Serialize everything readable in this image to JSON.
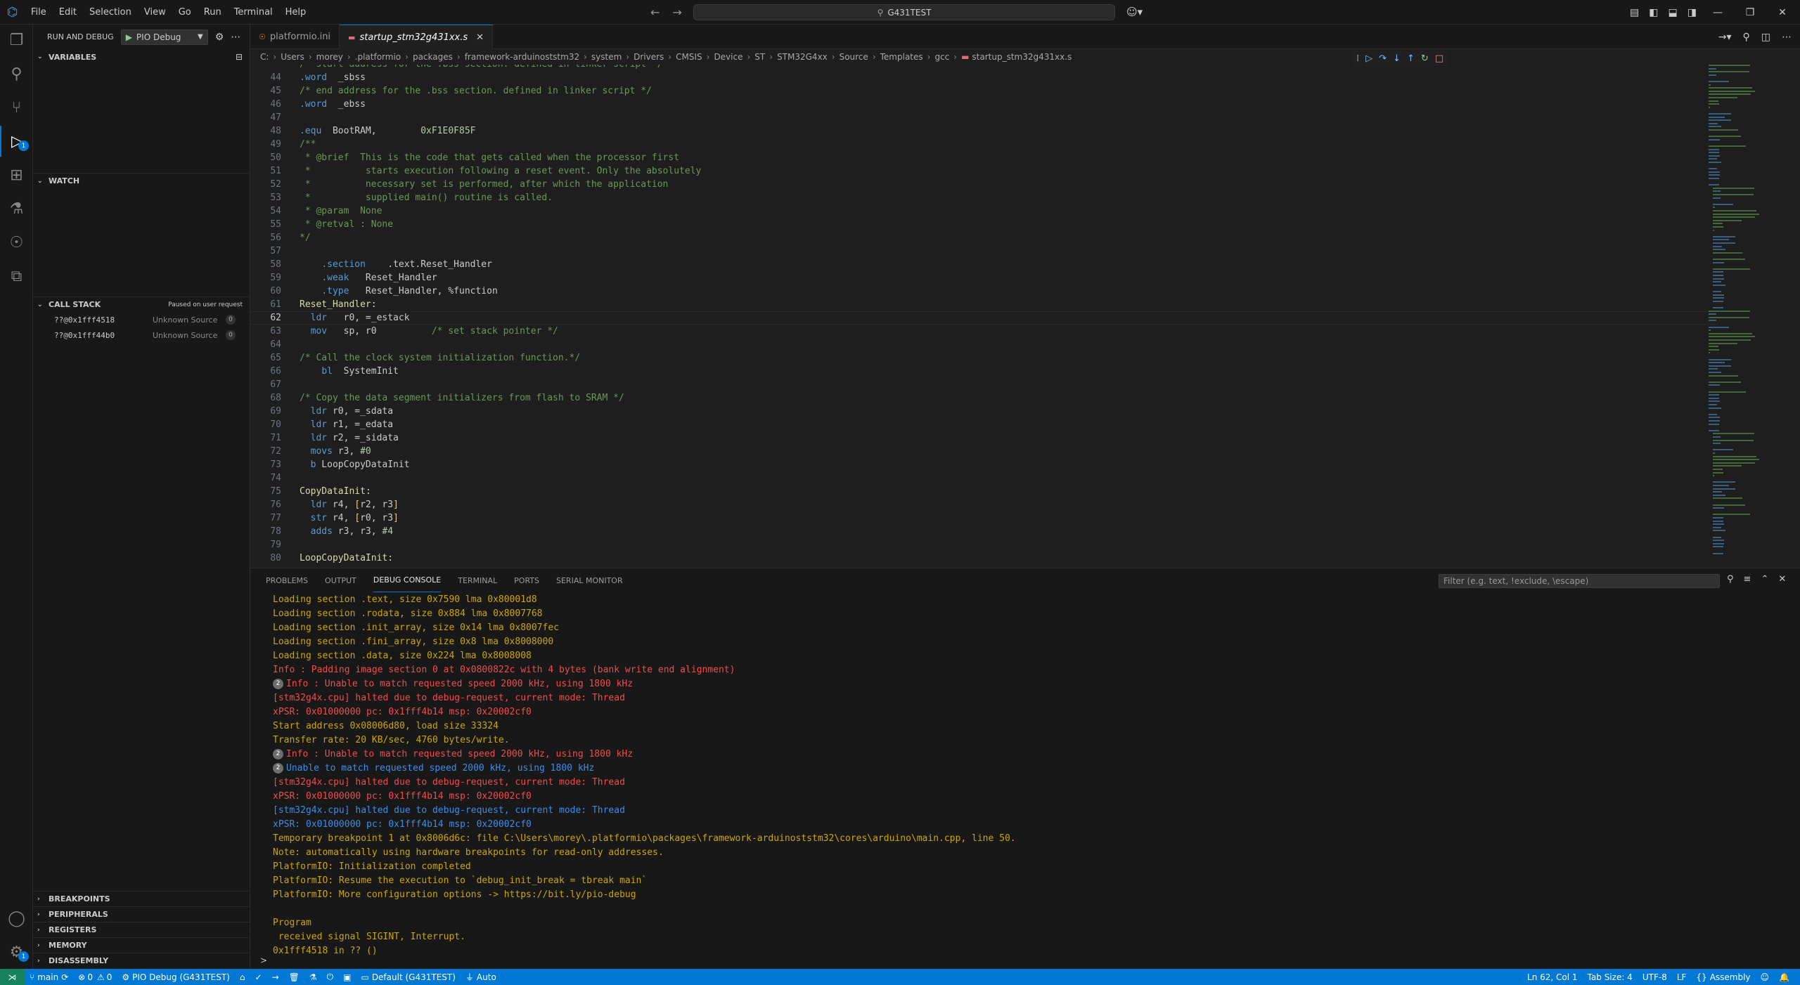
{
  "titlebar": {
    "menu": [
      "File",
      "Edit",
      "Selection",
      "View",
      "Go",
      "Run",
      "Terminal",
      "Help"
    ],
    "search": "G431TEST"
  },
  "sidebar": {
    "title": "RUN AND DEBUG",
    "config": "PIO Debug",
    "sections": {
      "variables": "VARIABLES",
      "watch": "WATCH",
      "callstack": "CALL STACK",
      "callstack_status": "Paused on user request",
      "breakpoints": "BREAKPOINTS",
      "peripherals": "PERIPHERALS",
      "registers": "REGISTERS",
      "memory": "MEMORY",
      "disassembly": "DISASSEMBLY"
    },
    "callstack": [
      {
        "fn": "??@0x1fff4518",
        "src": "Unknown Source",
        "count": "0"
      },
      {
        "fn": "??@0x1fff44b0",
        "src": "Unknown Source",
        "count": "0"
      }
    ]
  },
  "tabs": [
    {
      "label": "platformio.ini",
      "active": false
    },
    {
      "label": "startup_stm32g431xx.s",
      "active": true
    }
  ],
  "breadcrumb": [
    "C:",
    "Users",
    "morey",
    ".platformio",
    "packages",
    "framework-arduinoststm32",
    "system",
    "Drivers",
    "CMSIS",
    "Device",
    "ST",
    "STM32G4xx",
    "Source",
    "Templates",
    "gcc",
    "startup_stm32g431xx.s"
  ],
  "editor": {
    "current_line": 62,
    "lines": [
      {
        "n": "",
        "text": "/* start address for the .bss section. defined in linker script */"
      },
      {
        "n": "44",
        "text": ".word  _sbss"
      },
      {
        "n": "45",
        "text": "/* end address for the .bss section. defined in linker script */"
      },
      {
        "n": "46",
        "text": ".word  _ebss"
      },
      {
        "n": "47",
        "text": ""
      },
      {
        "n": "48",
        "text": ".equ  BootRAM,        0xF1E0F85F"
      },
      {
        "n": "49",
        "text": "/**"
      },
      {
        "n": "50",
        "text": " * @brief  This is the code that gets called when the processor first"
      },
      {
        "n": "51",
        "text": " *          starts execution following a reset event. Only the absolutely"
      },
      {
        "n": "52",
        "text": " *          necessary set is performed, after which the application"
      },
      {
        "n": "53",
        "text": " *          supplied main() routine is called."
      },
      {
        "n": "54",
        "text": " * @param  None"
      },
      {
        "n": "55",
        "text": " * @retval : None"
      },
      {
        "n": "56",
        "text": "*/"
      },
      {
        "n": "57",
        "text": ""
      },
      {
        "n": "58",
        "text": "    .section    .text.Reset_Handler"
      },
      {
        "n": "59",
        "text": "    .weak   Reset_Handler"
      },
      {
        "n": "60",
        "text": "    .type   Reset_Handler, %function"
      },
      {
        "n": "61",
        "text": "Reset_Handler:"
      },
      {
        "n": "62",
        "text": "  ldr   r0, =_estack"
      },
      {
        "n": "63",
        "text": "  mov   sp, r0          /* set stack pointer */"
      },
      {
        "n": "64",
        "text": ""
      },
      {
        "n": "65",
        "text": "/* Call the clock system initialization function.*/"
      },
      {
        "n": "66",
        "text": "    bl  SystemInit"
      },
      {
        "n": "67",
        "text": ""
      },
      {
        "n": "68",
        "text": "/* Copy the data segment initializers from flash to SRAM */"
      },
      {
        "n": "69",
        "text": "  ldr r0, =_sdata"
      },
      {
        "n": "70",
        "text": "  ldr r1, =_edata"
      },
      {
        "n": "71",
        "text": "  ldr r2, =_sidata"
      },
      {
        "n": "72",
        "text": "  movs r3, #0"
      },
      {
        "n": "73",
        "text": "  b LoopCopyDataInit"
      },
      {
        "n": "74",
        "text": ""
      },
      {
        "n": "75",
        "text": "CopyDataInit:"
      },
      {
        "n": "76",
        "text": "  ldr r4, [r2, r3]"
      },
      {
        "n": "77",
        "text": "  str r4, [r0, r3]"
      },
      {
        "n": "78",
        "text": "  adds r3, r3, #4"
      },
      {
        "n": "79",
        "text": ""
      },
      {
        "n": "80",
        "text": "LoopCopyDataInit:"
      }
    ]
  },
  "panel": {
    "tabs": [
      "PROBLEMS",
      "OUTPUT",
      "DEBUG CONSOLE",
      "TERMINAL",
      "PORTS",
      "SERIAL MONITOR"
    ],
    "active_tab": "DEBUG CONSOLE",
    "filter_placeholder": "Filter (e.g. text, !exclude, \\escape)",
    "console": [
      {
        "c": "yel",
        "t": "Loading section .text, size 0x7590 lma 0x80001d8"
      },
      {
        "c": "yel",
        "t": "Loading section .rodata, size 0x884 lma 0x8007768"
      },
      {
        "c": "yel",
        "t": "Loading section .init_array, size 0x14 lma 0x8007fec"
      },
      {
        "c": "yel",
        "t": "Loading section .fini_array, size 0x8 lma 0x8008000"
      },
      {
        "c": "yel",
        "t": "Loading section .data, size 0x224 lma 0x8008008"
      },
      {
        "c": "red",
        "t": "Info : Padding image section 0 at 0x0800822c with 4 bytes (bank write end alignment)"
      },
      {
        "c": "red",
        "t": "Info : Unable to match requested speed 2000 kHz, using 1800 kHz",
        "badge": "2"
      },
      {
        "c": "red",
        "t": "[stm32g4x.cpu] halted due to debug-request, current mode: Thread"
      },
      {
        "c": "red",
        "t": "xPSR: 0x01000000 pc: 0x1fff4b14 msp: 0x20002cf0"
      },
      {
        "c": "yel",
        "t": "Start address 0x08006d80, load size 33324"
      },
      {
        "c": "yel",
        "t": "Transfer rate: 20 KB/sec, 4760 bytes/write."
      },
      {
        "c": "red",
        "t": "Info : Unable to match requested speed 2000 kHz, using 1800 kHz",
        "badge": "2"
      },
      {
        "c": "blu",
        "t": "Unable to match requested speed 2000 kHz, using 1800 kHz",
        "badge": "2"
      },
      {
        "c": "red",
        "t": "[stm32g4x.cpu] halted due to debug-request, current mode: Thread"
      },
      {
        "c": "red",
        "t": "xPSR: 0x01000000 pc: 0x1fff4b14 msp: 0x20002cf0"
      },
      {
        "c": "blu",
        "t": "[stm32g4x.cpu] halted due to debug-request, current mode: Thread"
      },
      {
        "c": "blu",
        "t": "xPSR: 0x01000000 pc: 0x1fff4b14 msp: 0x20002cf0"
      },
      {
        "c": "yel",
        "t": "Temporary breakpoint 1 at 0x8006d6c: file C:\\Users\\morey\\.platformio\\packages\\framework-arduinoststm32\\cores\\arduino\\main.cpp, line 50."
      },
      {
        "c": "yel",
        "t": "Note: automatically using hardware breakpoints for read-only addresses."
      },
      {
        "c": "yel",
        "t": "PlatformIO: Initialization completed"
      },
      {
        "c": "yel",
        "t": "PlatformIO: Resume the execution to `debug_init_break = tbreak main`"
      },
      {
        "c": "yel",
        "t": "PlatformIO: More configuration options -> https://bit.ly/pio-debug"
      },
      {
        "c": "yel",
        "t": ""
      },
      {
        "c": "yel",
        "t": "Program"
      },
      {
        "c": "yel",
        "t": " received signal SIGINT, Interrupt."
      },
      {
        "c": "yel",
        "t": "0x1fff4518 in ?? ()"
      }
    ],
    "prompt": ">"
  },
  "statusbar": {
    "branch": "main",
    "errors": "0",
    "warnings": "0",
    "debug": "PIO Debug (G431TEST)",
    "env": "Default (G431TEST)",
    "auto": "Auto",
    "position": "Ln 62, Col 1",
    "tabsize": "Tab Size: 4",
    "encoding": "UTF-8",
    "eol": "LF",
    "language": "Assembly"
  },
  "colors": {
    "accent": "#0078d4",
    "statusbar": "#0078d4"
  }
}
